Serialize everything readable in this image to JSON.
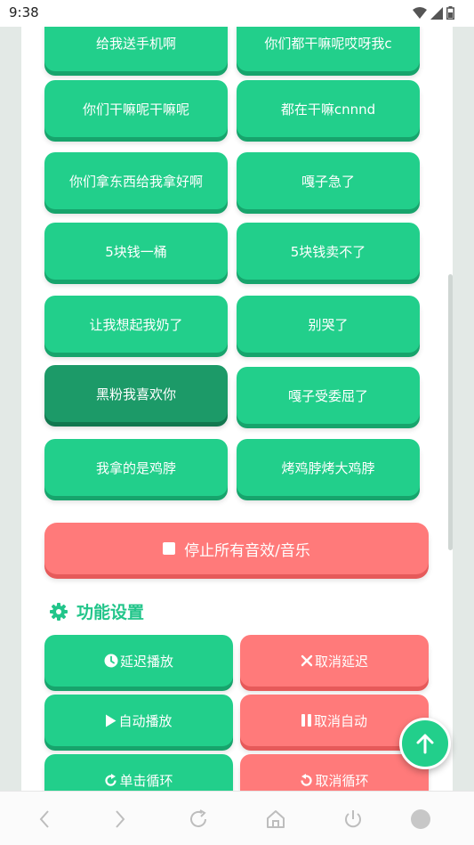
{
  "status_bar": {
    "time": "9:38",
    "icons": [
      "wifi-icon",
      "signal-icon",
      "battery-icon"
    ]
  },
  "sound_buttons": [
    {
      "label": "给我送手机啊"
    },
    {
      "label": "你们都干嘛呢哎呀我c"
    },
    {
      "label": "你们干嘛呢干嘛呢"
    },
    {
      "label": "都在干嘛cnnnd"
    },
    {
      "label": "你们拿东西给我拿好啊"
    },
    {
      "label": "嘎子急了"
    },
    {
      "label": "5块钱一桶"
    },
    {
      "label": "5块钱卖不了"
    },
    {
      "label": "让我想起我奶了"
    },
    {
      "label": "别哭了"
    },
    {
      "label": "黑粉我喜欢你",
      "pressed": true
    },
    {
      "label": "嘎子受委屈了"
    },
    {
      "label": "我拿的是鸡脖"
    },
    {
      "label": "烤鸡脖烤大鸡脖"
    }
  ],
  "stop_button": {
    "label": "停止所有音效/音乐",
    "icon": "stop-square-icon"
  },
  "settings": {
    "title": "功能设置",
    "icon": "gear-icon",
    "buttons": [
      {
        "label": "延迟播放",
        "icon": "clock-icon"
      },
      {
        "label": "取消延迟",
        "icon": "close-x-icon"
      },
      {
        "label": "自动播放",
        "icon": "play-icon"
      },
      {
        "label": "取消自动",
        "icon": "pause-icon"
      },
      {
        "label": "单击循环",
        "icon": "redo-icon"
      },
      {
        "label": "取消循环",
        "icon": "undo-icon"
      }
    ]
  },
  "fab": {
    "icon": "arrow-up-icon"
  },
  "nav_bar": {
    "items": [
      "back-icon",
      "forward-icon",
      "refresh-icon",
      "home-icon",
      "power-icon",
      "profile-circle-icon"
    ]
  },
  "colors": {
    "green": "#22cf8b",
    "green_pressed": "#1c9a68",
    "red": "#ff7a7a",
    "accent_text": "#22c58a"
  }
}
